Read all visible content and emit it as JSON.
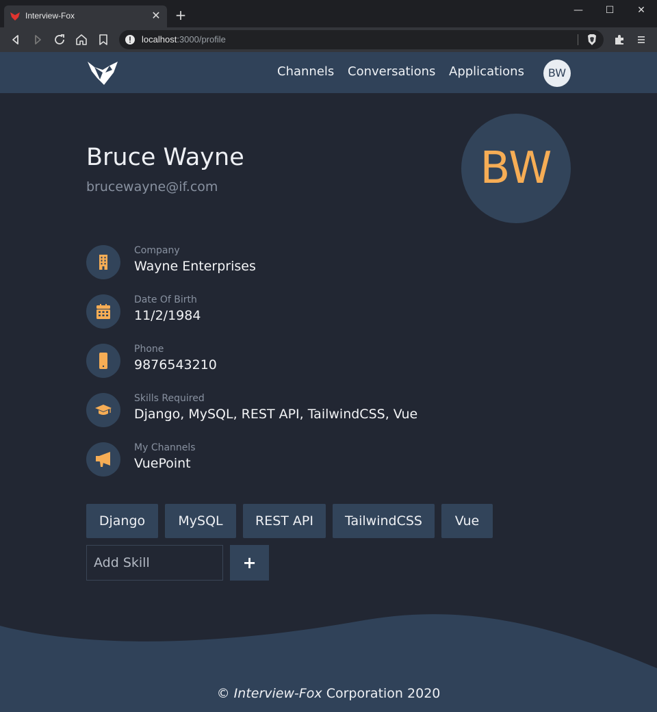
{
  "browser": {
    "tab_title": "Interview-Fox",
    "tab_close": "✕",
    "new_tab": "+",
    "window_controls": {
      "minimize": "—",
      "maximize": "☐",
      "close": "✕"
    },
    "url_host": "localhost",
    "url_path": ":3000/profile"
  },
  "nav": {
    "links": [
      "Channels",
      "Conversations",
      "Applications"
    ],
    "avatar_initials": "BW"
  },
  "profile": {
    "name": "Bruce Wayne",
    "email": "brucewayne@if.com",
    "avatar_initials": "BW",
    "fields": [
      {
        "label": "Company",
        "value": "Wayne Enterprises",
        "icon": "building-icon"
      },
      {
        "label": "Date Of Birth",
        "value": "11/2/1984",
        "icon": "calendar-icon"
      },
      {
        "label": "Phone",
        "value": "9876543210",
        "icon": "mobile-phone-icon"
      },
      {
        "label": "Skills Required",
        "value": "Django, MySQL, REST API, TailwindCSS, Vue",
        "icon": "graduation-cap-icon"
      },
      {
        "label": "My Channels",
        "value": "VuePoint",
        "icon": "megaphone-icon"
      }
    ]
  },
  "skills": {
    "tags": [
      "Django",
      "MySQL",
      "REST API",
      "TailwindCSS",
      "Vue"
    ],
    "input_placeholder": "Add Skill",
    "add_button": "+"
  },
  "footer": {
    "copyright_symbol": "©",
    "brand": "Interview-Fox",
    "suffix": "Corporation 2020"
  },
  "colors": {
    "background": "#222733",
    "nav_background": "#304259",
    "card": "#32445a",
    "accent": "#f6ad55",
    "muted_text": "#8891a0"
  }
}
